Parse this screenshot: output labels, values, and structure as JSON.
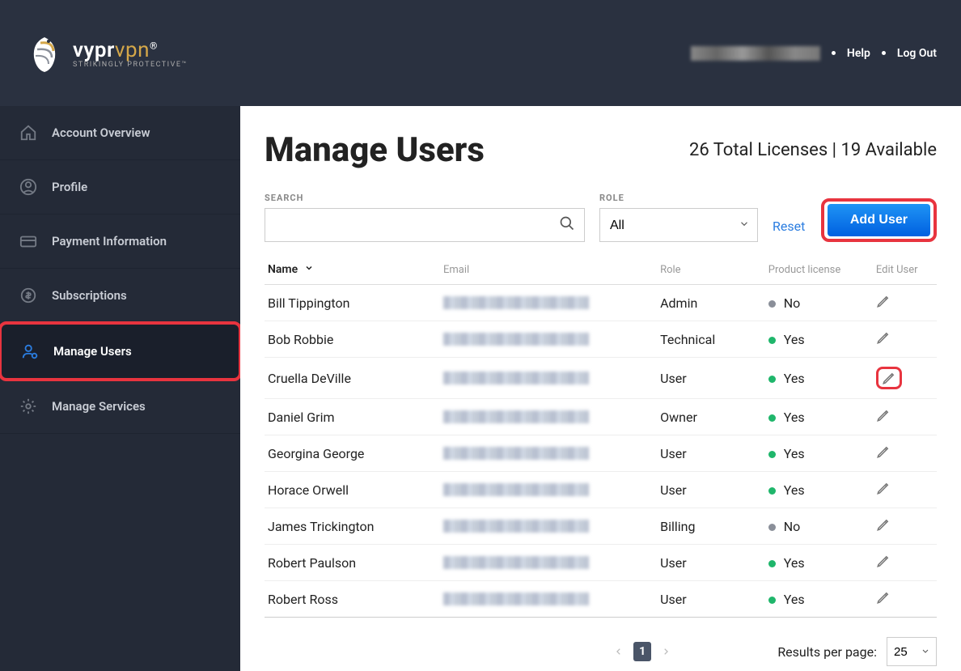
{
  "header": {
    "brand_main": "vypr",
    "brand_accent": "vpn",
    "brand_reg": "®",
    "tagline": "STRIKINGLY PROTECTIVE™",
    "help": "Help",
    "logout": "Log Out"
  },
  "sidebar": {
    "items": [
      {
        "label": "Account Overview"
      },
      {
        "label": "Profile"
      },
      {
        "label": "Payment Information"
      },
      {
        "label": "Subscriptions"
      },
      {
        "label": "Manage Users"
      },
      {
        "label": "Manage Services"
      }
    ]
  },
  "main": {
    "title": "Manage Users",
    "license_total": "26 Total Licenses",
    "license_sep": " | ",
    "license_avail": "19 Available",
    "search_label": "SEARCH",
    "role_label": "ROLE",
    "role_selected": "All",
    "reset": "Reset",
    "add_user": "Add User"
  },
  "table": {
    "cols": {
      "name": "Name",
      "email": "Email",
      "role": "Role",
      "license": "Product license",
      "edit": "Edit User"
    },
    "rows": [
      {
        "name": "Bill Tippington",
        "role": "Admin",
        "license": "No",
        "dot": "gray"
      },
      {
        "name": "Bob Robbie",
        "role": "Technical",
        "license": "Yes",
        "dot": "green"
      },
      {
        "name": "Cruella DeVille",
        "role": "User",
        "license": "Yes",
        "dot": "green",
        "edit_highlight": true
      },
      {
        "name": "Daniel Grim",
        "role": "Owner",
        "license": "Yes",
        "dot": "green"
      },
      {
        "name": "Georgina George",
        "role": "User",
        "license": "Yes",
        "dot": "green"
      },
      {
        "name": "Horace Orwell",
        "role": "User",
        "license": "Yes",
        "dot": "green"
      },
      {
        "name": "James Trickington",
        "role": "Billing",
        "license": "No",
        "dot": "gray"
      },
      {
        "name": "Robert Paulson",
        "role": "User",
        "license": "Yes",
        "dot": "green"
      },
      {
        "name": "Robert Ross",
        "role": "User",
        "license": "Yes",
        "dot": "green"
      }
    ]
  },
  "pagination": {
    "page": "1",
    "results_label": "Results per page:",
    "per_page": "25"
  }
}
